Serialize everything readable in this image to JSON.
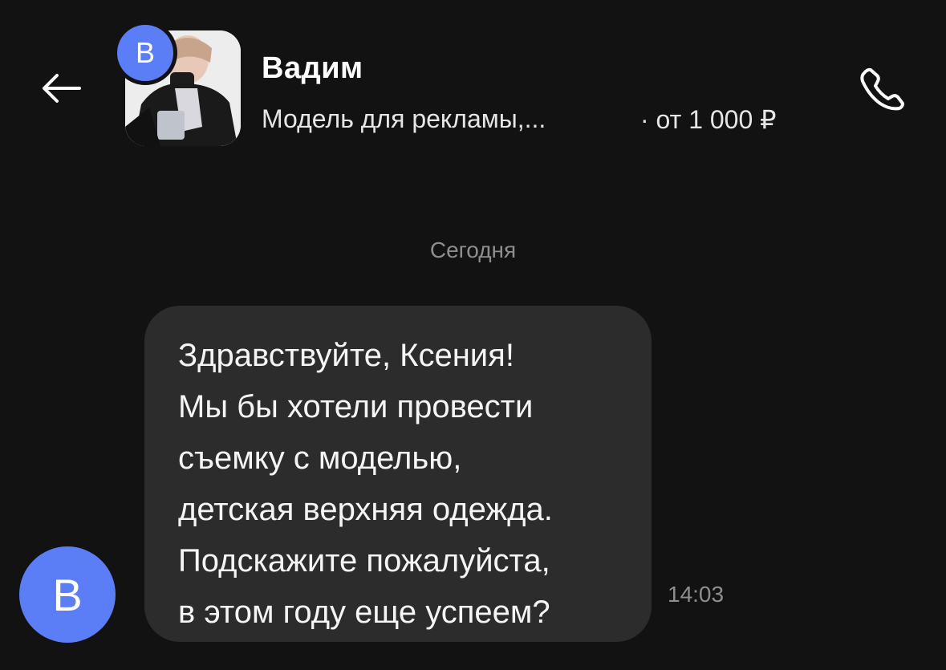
{
  "header": {
    "back_icon": "arrow-left-icon",
    "avatar_letter": "B",
    "contact_name": "Вадим",
    "listing_title": "Модель для рекламы,...",
    "listing_price": "· от 1 000 ₽",
    "call_icon": "phone-icon"
  },
  "chat": {
    "date_separator": "Сегодня",
    "messages": [
      {
        "avatar_letter": "B",
        "lines": [
          "Здравствуйте, Ксения!",
          "Мы бы хотели провести",
          "съемку с моделью,",
          "детская верхняя одежда.",
          "Подскажите пожалуйста,",
          "в этом году еще успеем?"
        ],
        "time": "14:03"
      }
    ]
  },
  "colors": {
    "background": "#121212",
    "bubble": "#2c2c2c",
    "avatar": "#5b7ef7",
    "muted_text": "#8e8e8e"
  }
}
